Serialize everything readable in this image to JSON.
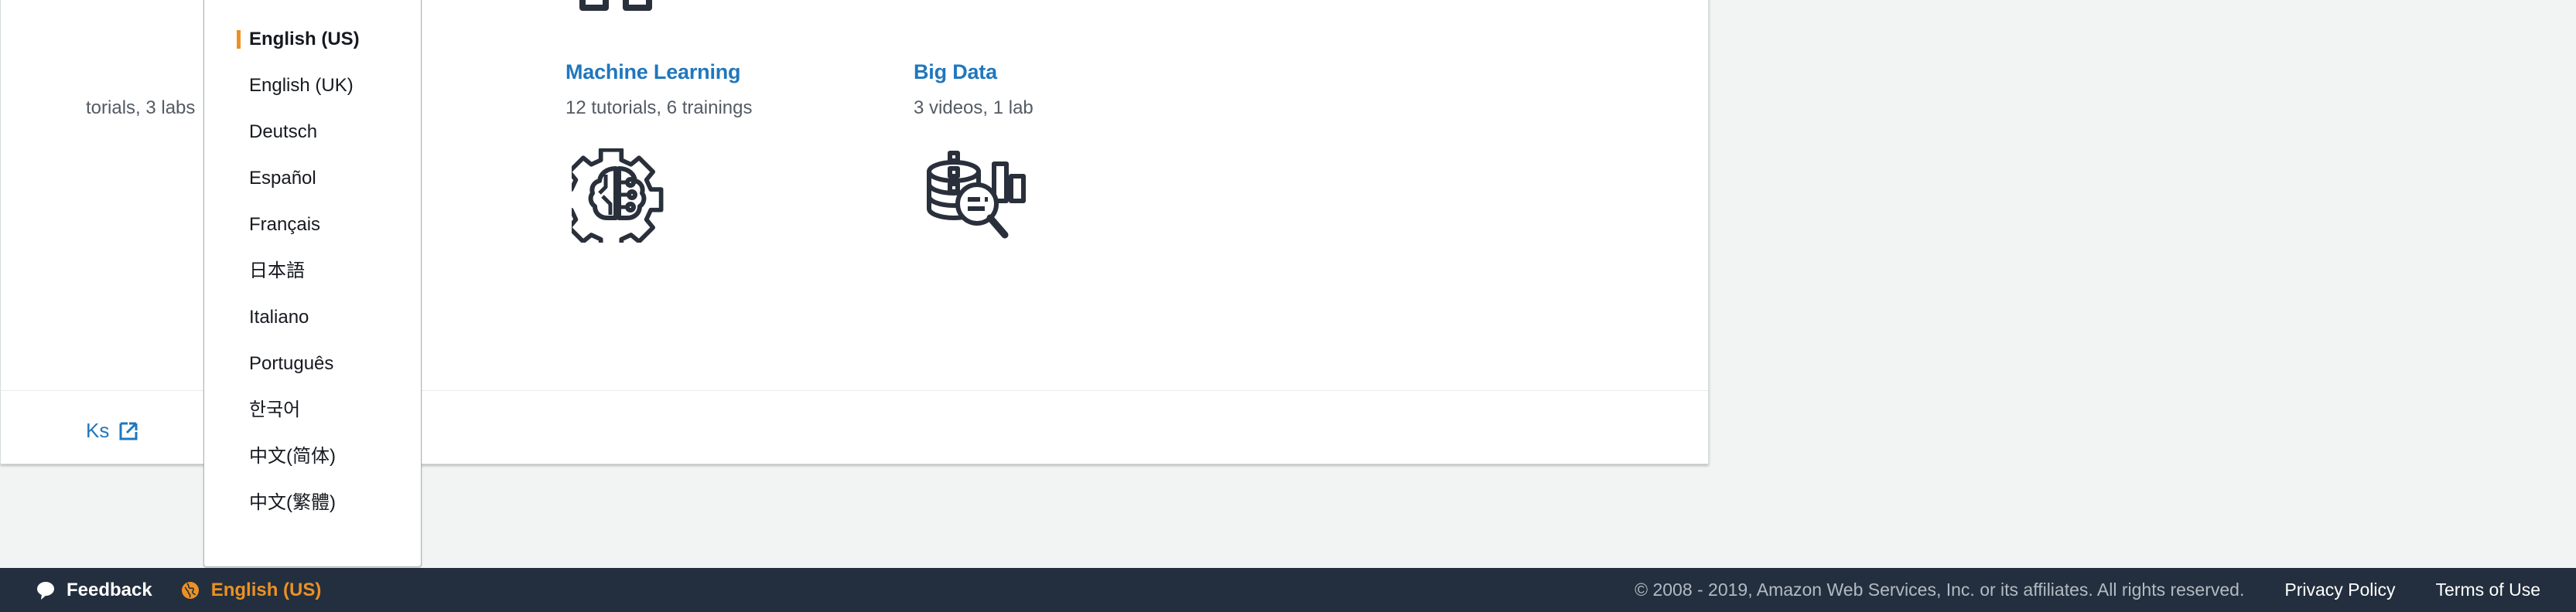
{
  "content": {
    "tiles": [
      {
        "title": "",
        "subtitle": "torials, 3 labs",
        "icon_top": "compute-instance-icon",
        "icon_bottom": "hidden-icon"
      },
      {
        "title": "Machine Learning",
        "subtitle": "12 tutorials, 6 trainings",
        "icon_top": "robot-machine-learning-icon",
        "icon_bottom": "gear-brain-icon"
      },
      {
        "title": "Big Data",
        "subtitle": "3 videos, 1 lab",
        "icon_top": "database-stack-icon",
        "icon_bottom": "data-analytics-icon"
      }
    ],
    "external_link": {
      "label": "Ks",
      "icon": "external-link-icon"
    }
  },
  "language_dropdown": {
    "selected": "English (US)",
    "items": [
      "English (US)",
      "English (UK)",
      "Deutsch",
      "Español",
      "Français",
      "日本語",
      "Italiano",
      "Português",
      "한국어",
      "中文(简体)",
      "中文(繁體)"
    ]
  },
  "footer": {
    "feedback_label": "Feedback",
    "feedback_icon": "speech-bubble-icon",
    "language_label": "English (US)",
    "language_icon": "globe-icon",
    "copyright": "© 2008 - 2019, Amazon Web Services, Inc. or its affiliates. All rights reserved.",
    "privacy_policy": "Privacy Policy",
    "terms_of_use": "Terms of Use"
  },
  "colors": {
    "footer_bg": "#232f3e",
    "accent_orange": "#ec9123",
    "link_blue": "#2077bd",
    "page_bg": "#f2f3f3",
    "icon_dark": "#29303b"
  }
}
